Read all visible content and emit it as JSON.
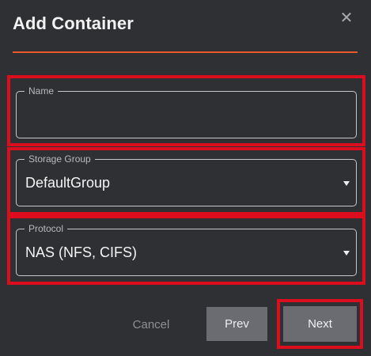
{
  "dialog": {
    "title": "Add Container",
    "close_glyph": "✕"
  },
  "form": {
    "name": {
      "label": "Name",
      "value": ""
    },
    "storage_group": {
      "label": "Storage Group",
      "value": "DefaultGroup"
    },
    "protocol": {
      "label": "Protocol",
      "value": "NAS (NFS, CIFS)"
    }
  },
  "footer": {
    "cancel_label": "Cancel",
    "prev_label": "Prev",
    "next_label": "Next"
  },
  "colors": {
    "background": "#2f3033",
    "accent": "#e8582a",
    "highlight": "#dc0d1f",
    "button": "#6a6c72"
  }
}
